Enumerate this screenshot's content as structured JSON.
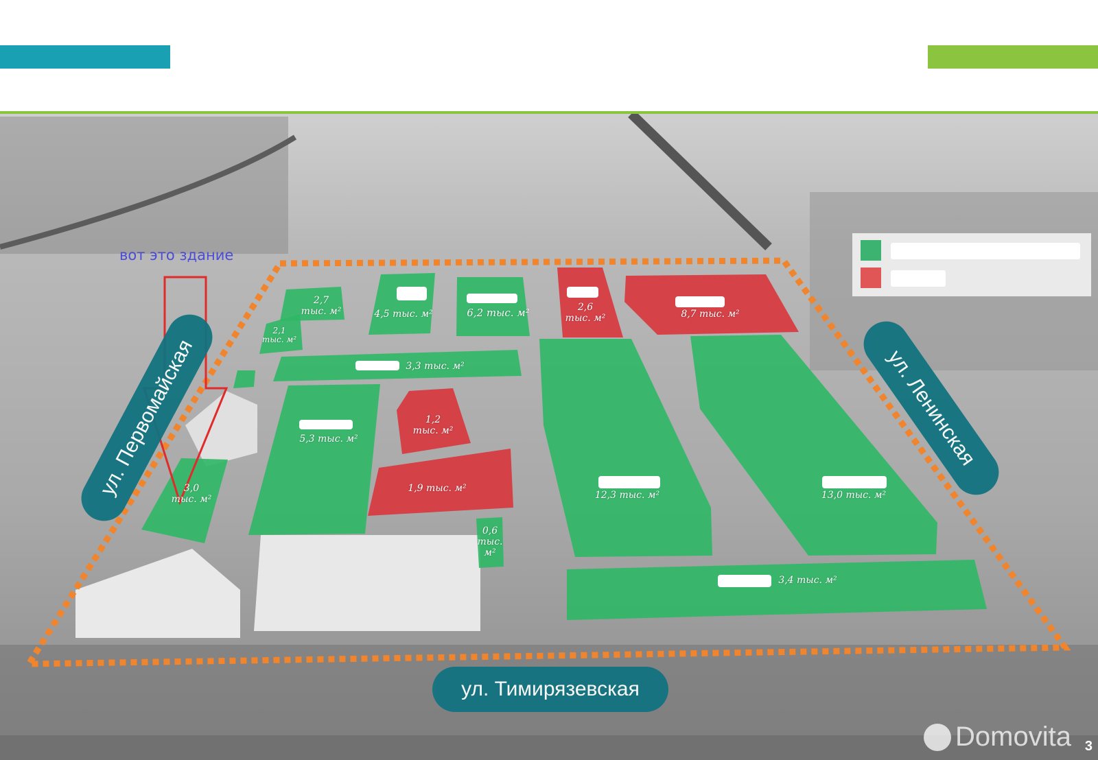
{
  "header": {
    "accent_left": "#1aa0b3",
    "accent_right": "#8bc53f"
  },
  "legend": {
    "items": [
      {
        "color": "#3cb371",
        "label": ""
      },
      {
        "color": "#e05555",
        "label": ""
      }
    ]
  },
  "annotation": {
    "text": "вот это здание"
  },
  "streets": {
    "pervomaiskaya": "ул. Первомайская",
    "leninskaya": "ул. Ленинская",
    "timiryazevskaya": "ул. Тимирязевская"
  },
  "buildings": [
    {
      "id": "b27",
      "label": "2,7\nтыс. м²",
      "status": "green"
    },
    {
      "id": "b21",
      "label": "2,1\nтыс. м²",
      "status": "green"
    },
    {
      "id": "b45",
      "label": "4,5 тыс. м²",
      "status": "green"
    },
    {
      "id": "b62",
      "label": "6,2 тыс. м²",
      "status": "green"
    },
    {
      "id": "b26",
      "label": "2,6\nтыс. м²",
      "status": "red"
    },
    {
      "id": "b87",
      "label": "8,7 тыс. м²",
      "status": "red"
    },
    {
      "id": "b33",
      "label": "3,3 тыс. м²",
      "status": "green"
    },
    {
      "id": "b53",
      "label": "5,3 тыс. м²",
      "status": "green"
    },
    {
      "id": "b12",
      "label": "1,2\nтыс. м²",
      "status": "red"
    },
    {
      "id": "b19",
      "label": "1,9 тыс. м²",
      "status": "red"
    },
    {
      "id": "b30",
      "label": "3,0\nтыс. м²",
      "status": "green"
    },
    {
      "id": "b06",
      "label": "0,6\nтыс.\nм²",
      "status": "green"
    },
    {
      "id": "b123",
      "label": "12,3 тыс. м²",
      "status": "green"
    },
    {
      "id": "b130",
      "label": "13,0 тыс. м²",
      "status": "green"
    },
    {
      "id": "b34",
      "label": "3,4 тыс. м²",
      "status": "green"
    }
  ],
  "colors": {
    "green": "#2fb866",
    "red": "#d8353c",
    "boundary": "#f0852d"
  },
  "watermark": "Domovita",
  "page_number": "3"
}
